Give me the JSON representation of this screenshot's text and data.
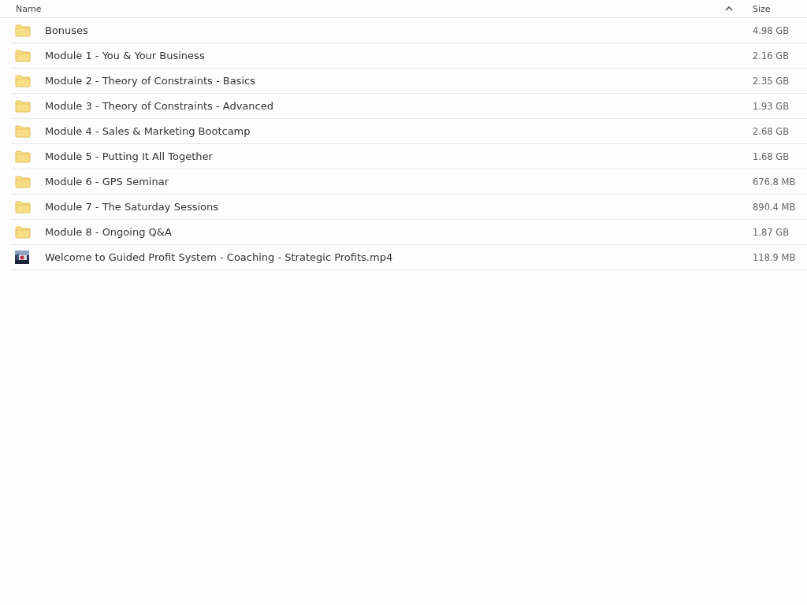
{
  "table": {
    "columns": [
      {
        "label": "Name",
        "sorted": true
      },
      {
        "label": "Size",
        "sorted": false
      }
    ],
    "rows": [
      {
        "kind": "folder",
        "name": "Bonuses",
        "size": "4.98 GB"
      },
      {
        "kind": "folder",
        "name": "Module 1 - You & Your Business",
        "size": "2.16 GB"
      },
      {
        "kind": "folder",
        "name": "Module 2 - Theory of Constraints - Basics",
        "size": "2.35 GB"
      },
      {
        "kind": "folder",
        "name": "Module 3 - Theory of Constraints - Advanced",
        "size": "1.93 GB"
      },
      {
        "kind": "folder",
        "name": "Module 4 - Sales & Marketing Bootcamp",
        "size": "2.68 GB"
      },
      {
        "kind": "folder",
        "name": "Module 5 - Putting It All Together",
        "size": "1.68 GB"
      },
      {
        "kind": "folder",
        "name": "Module 6 - GPS Seminar",
        "size": "676.8 MB"
      },
      {
        "kind": "folder",
        "name": "Module 7 - The Saturday Sessions",
        "size": "890.4 MB"
      },
      {
        "kind": "folder",
        "name": "Module 8 - Ongoing Q&A",
        "size": "1.87 GB"
      },
      {
        "kind": "video",
        "name": "Welcome to Guided Profit System - Coaching - Strategic Profits.mp4",
        "size": "118.9 MB"
      }
    ]
  }
}
